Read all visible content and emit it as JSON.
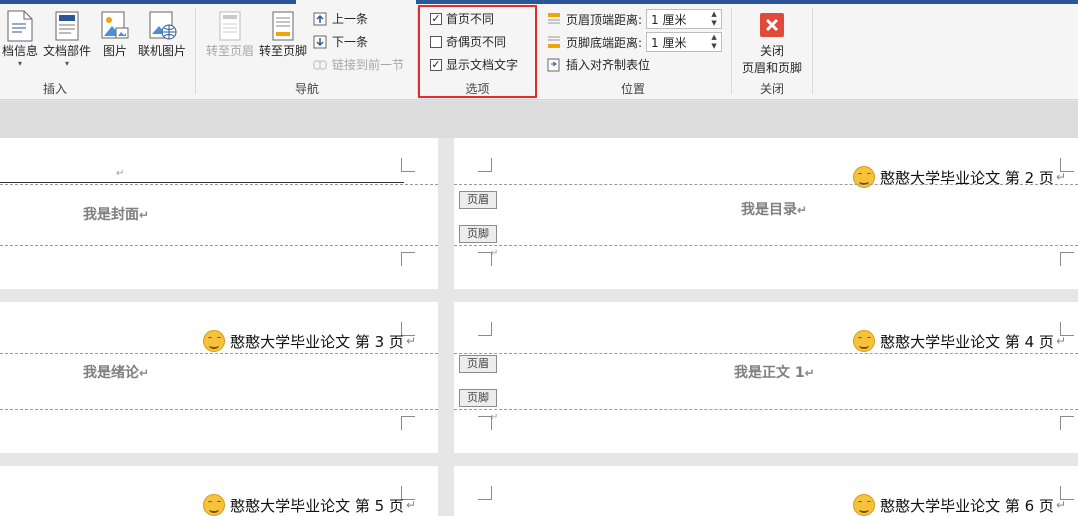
{
  "ribbon": {
    "insert_group": {
      "doc_info": "档信息",
      "doc_parts": "文档部件",
      "picture": "图片",
      "online_picture": "联机图片",
      "label": "插入"
    },
    "nav_group": {
      "goto_header": "转至页眉",
      "goto_footer": "转至页脚",
      "prev": "上一条",
      "next": "下一条",
      "link_prev": "链接到前一节",
      "label": "导航"
    },
    "options_group": {
      "first_page_diff": "首页不同",
      "odd_even_diff": "奇偶页不同",
      "show_doc_text": "显示文档文字",
      "label": "选项",
      "first_page_checked": "✓",
      "odd_even_checked": "",
      "show_doc_checked": "✓"
    },
    "position_group": {
      "header_top_label": "页眉顶端距离:",
      "header_top_value": "1 厘米",
      "footer_bottom_label": "页脚底端距离:",
      "footer_bottom_value": "1 厘米",
      "insert_align_tab": "插入对齐制表位",
      "label": "位置"
    },
    "close_group": {
      "close_line1": "关闭",
      "close_line2": "页眉和页脚",
      "label": "关闭"
    }
  },
  "pages": {
    "p1_body": "我是封面",
    "p2_header": "憨憨大学毕业论文  第 2 页",
    "p2_body": "我是目录",
    "p3_header": "憨憨大学毕业论文  第 3 页",
    "p3_body": "我是绪论",
    "p4_header": "憨憨大学毕业论文  第 4 页",
    "p4_body": "我是正文 1",
    "p5_header": "憨憨大学毕业论文  第 5 页",
    "p6_header": "憨憨大学毕业论文  第 6 页",
    "header_tag": "页眉",
    "footer_tag": "页脚",
    "return_mark": "↵"
  },
  "colors": {
    "accent": "#2b579a",
    "highlight_box": "#e02c2c",
    "close_icon": "#e04a3b"
  }
}
